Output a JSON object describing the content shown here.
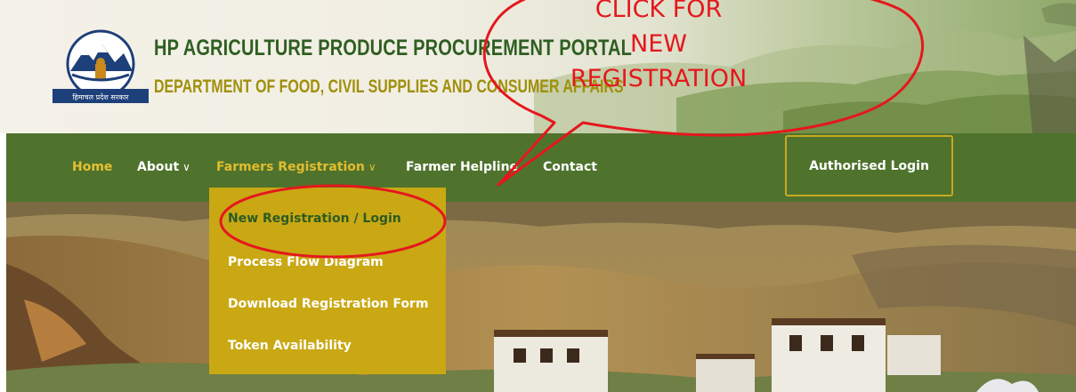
{
  "header": {
    "title": "HP AGRICULTURE PRODUCE PROCUREMENT PORTAL",
    "subtitle": "DEPARTMENT OF FOOD, CIVIL SUPPLIES AND CONSUMER AFFAIRS",
    "logo_text": "हिमाचल प्रदेश सरकार"
  },
  "nav": {
    "items": [
      {
        "label": "Home"
      },
      {
        "label": "About",
        "icon": "chevron-down-icon"
      },
      {
        "label": "Farmers Registration",
        "icon": "chevron-down-icon"
      },
      {
        "label": "Farmer Helpline"
      },
      {
        "label": "Contact"
      }
    ],
    "login_button": "Authorised Login",
    "caret": "∨"
  },
  "dropdown": {
    "items": [
      {
        "label": "New Registration / Login"
      },
      {
        "label": "Process Flow Diagram"
      },
      {
        "label": "Download Registration Form"
      },
      {
        "label": "Token Availability"
      }
    ]
  },
  "annotation": {
    "lines": [
      "CLICK FOR",
      "NEW",
      "REGISTRATION"
    ]
  },
  "colors": {
    "nav_bg": "#4f732d",
    "dropdown_bg": "#c9a814",
    "title_green": "#2f5e21",
    "subtitle_gold": "#a0900b",
    "annotation_red": "#e5171d"
  }
}
